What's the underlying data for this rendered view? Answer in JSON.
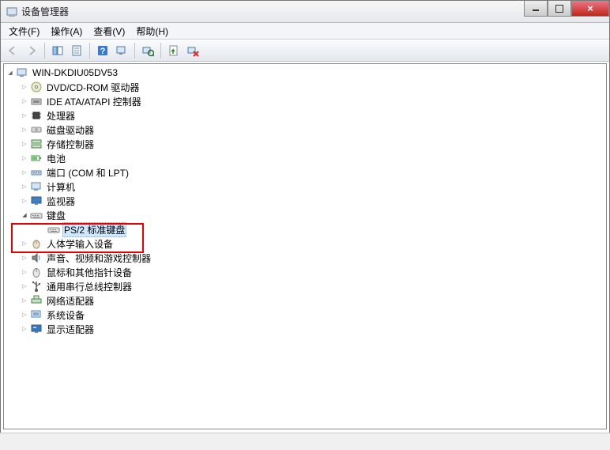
{
  "window": {
    "title": "设备管理器"
  },
  "menu": {
    "file": "文件(F)",
    "action": "操作(A)",
    "view": "查看(V)",
    "help": "帮助(H)"
  },
  "tree": {
    "root": "WIN-DKDIU05DV53",
    "nodes": [
      {
        "label": "DVD/CD-ROM 驱动器",
        "icon": "disc"
      },
      {
        "label": "IDE ATA/ATAPI 控制器",
        "icon": "ide"
      },
      {
        "label": "处理器",
        "icon": "cpu"
      },
      {
        "label": "磁盘驱动器",
        "icon": "drive"
      },
      {
        "label": "存储控制器",
        "icon": "storage"
      },
      {
        "label": "电池",
        "icon": "battery"
      },
      {
        "label": "端口 (COM 和 LPT)",
        "icon": "port"
      },
      {
        "label": "计算机",
        "icon": "computer"
      },
      {
        "label": "监视器",
        "icon": "monitor"
      },
      {
        "label": "键盘",
        "icon": "keyboard",
        "expanded": true,
        "children": [
          {
            "label": "PS/2 标准键盘",
            "icon": "keyboard",
            "selected": true
          }
        ]
      },
      {
        "label": "人体学输入设备",
        "icon": "hid"
      },
      {
        "label": "声音、视频和游戏控制器",
        "icon": "sound"
      },
      {
        "label": "鼠标和其他指针设备",
        "icon": "mouse"
      },
      {
        "label": "通用串行总线控制器",
        "icon": "usb"
      },
      {
        "label": "网络适配器",
        "icon": "network"
      },
      {
        "label": "系统设备",
        "icon": "system"
      },
      {
        "label": "显示适配器",
        "icon": "display"
      }
    ]
  }
}
